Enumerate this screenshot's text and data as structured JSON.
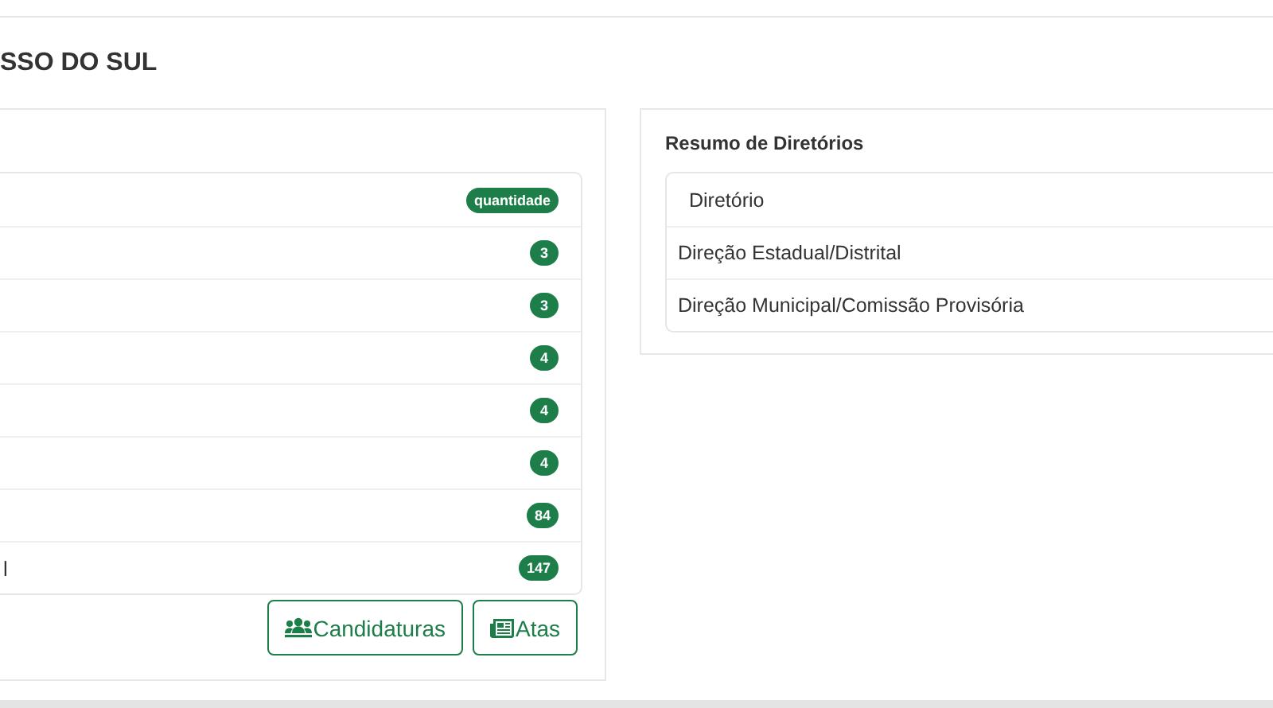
{
  "page_title": "SSO DO SUL",
  "quantities": {
    "header_badge": "quantidade",
    "rows": [
      {
        "count": "3"
      },
      {
        "count": "3"
      },
      {
        "count": "4"
      },
      {
        "count": "4"
      },
      {
        "count": "4"
      },
      {
        "count": "84"
      },
      {
        "label": "l",
        "count": "147"
      }
    ],
    "buttons": [
      "Candidaturas",
      "Atas"
    ]
  },
  "directories": {
    "title": "Resumo de Diretórios",
    "header": "Diretório",
    "rows": [
      "Direção Estadual/Distrital",
      "Direção Municipal/Comissão Provisória"
    ]
  }
}
